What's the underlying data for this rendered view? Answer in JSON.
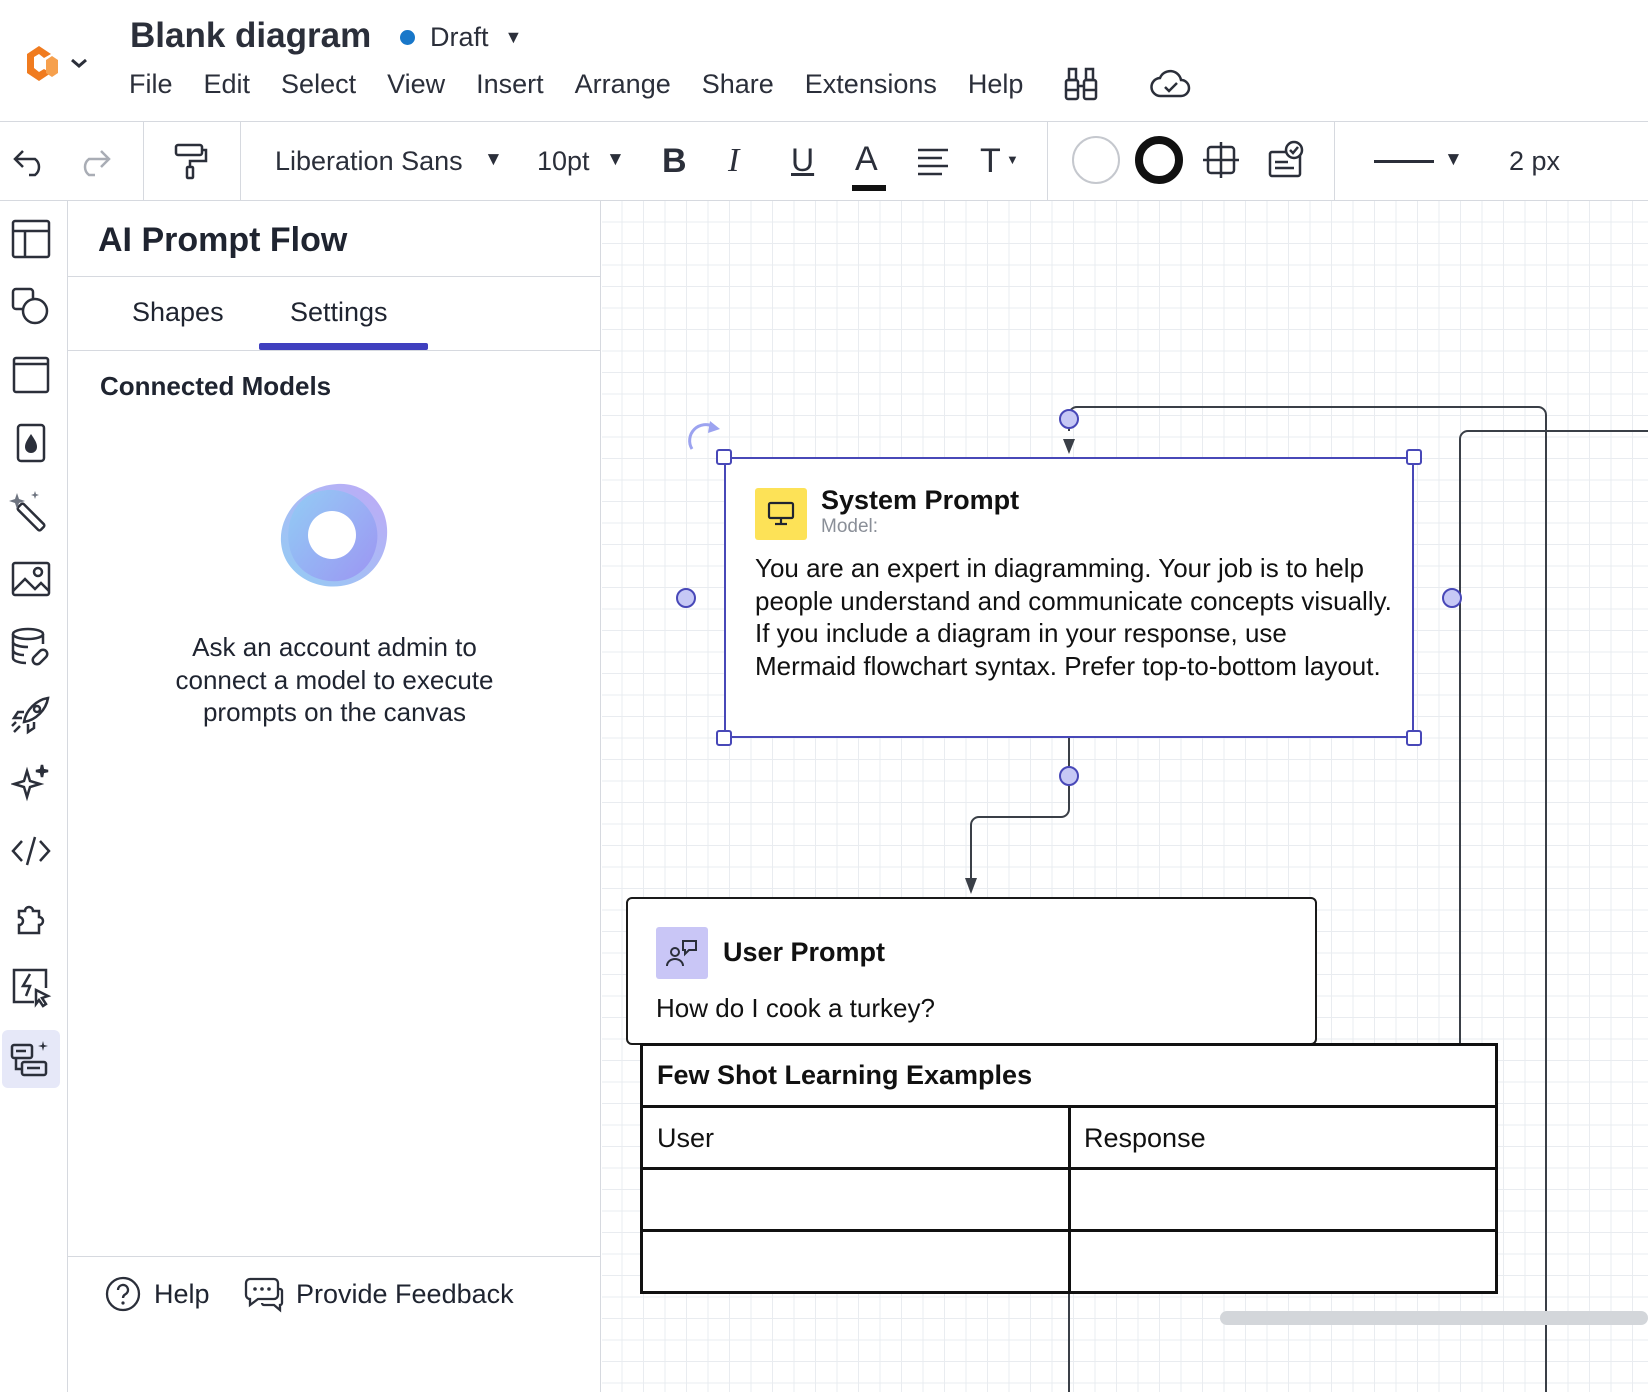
{
  "header": {
    "doc_title": "Blank diagram",
    "status": "Draft",
    "menu": [
      "File",
      "Edit",
      "Select",
      "View",
      "Insert",
      "Arrange",
      "Share",
      "Extensions",
      "Help"
    ]
  },
  "toolbar": {
    "font_family": "Liberation Sans",
    "font_size": "10pt",
    "bold": "B",
    "italic": "I",
    "underline": "U",
    "font_color": "A",
    "text_options": "T",
    "line_width": "2 px"
  },
  "panel": {
    "title": "AI Prompt Flow",
    "tabs": [
      {
        "label": "Shapes"
      },
      {
        "label": "Settings"
      }
    ],
    "active_tab": "Settings",
    "section_title": "Connected Models",
    "notice": "Ask an account admin to connect a model to execute prompts on the canvas",
    "footer": {
      "help": "Help",
      "feedback": "Provide Feedback"
    }
  },
  "canvas": {
    "system_prompt": {
      "title": "System Prompt",
      "model_label": "Model:",
      "body": "You are an expert in diagramming. Your job is to help people understand and communicate concepts visually. If you include a diagram in your response, use Mermaid flowchart syntax. Prefer top-to-bottom layout."
    },
    "user_prompt": {
      "title": "User Prompt",
      "body": "How do I cook a turkey?"
    },
    "few_shot": {
      "title": "Few Shot Learning Examples",
      "columns": [
        "User",
        "Response"
      ]
    }
  },
  "colors": {
    "accent": "#3f3fbf",
    "selection": "#4848b8",
    "status_dot": "#1877c9",
    "logo": "#f07b1f",
    "system_icon_bg": "#fde257",
    "user_icon_bg": "#c9c6f6"
  }
}
